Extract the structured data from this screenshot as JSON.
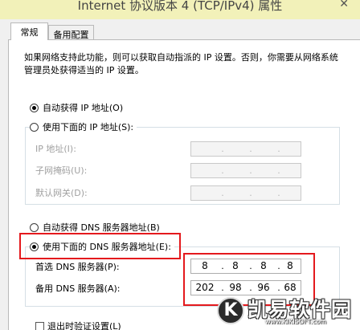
{
  "window": {
    "title": "Internet 协议版本 4 (TCP/IPv4) 属性",
    "close_glyph": "✕"
  },
  "tabs": [
    {
      "label": "常规",
      "active": true
    },
    {
      "label": "备用配置",
      "active": false
    }
  ],
  "description": "如果网络支持此功能，则可以获取自动指派的 IP 设置。否则，你需要从网络系统管理员处获得适当的 IP 设置。",
  "ip_section": {
    "auto_label": "自动获得 IP 地址(O)",
    "auto_selected": true,
    "manual_label": "使用下面的 IP 地址(S):",
    "manual_selected": false,
    "fields": [
      {
        "label": "IP 地址(I):",
        "value": [
          "",
          "",
          "",
          ""
        ],
        "enabled": false
      },
      {
        "label": "子网掩码(U):",
        "value": [
          "",
          "",
          "",
          ""
        ],
        "enabled": false
      },
      {
        "label": "默认网关(D):",
        "value": [
          "",
          "",
          "",
          ""
        ],
        "enabled": false
      }
    ]
  },
  "dns_section": {
    "auto_label": "自动获得 DNS 服务器地址(B)",
    "auto_selected": false,
    "manual_label": "使用下面的 DNS 服务器地址(E):",
    "manual_selected": true,
    "fields": [
      {
        "label": "首选 DNS 服务器(P):",
        "value": [
          "8",
          "8",
          "8",
          "8"
        ],
        "enabled": true
      },
      {
        "label": "备用 DNS 服务器(A):",
        "value": [
          "202",
          "98",
          "96",
          "68"
        ],
        "enabled": true
      }
    ]
  },
  "validate_checkbox": {
    "label": "退出时验证设置(L)",
    "checked": false
  },
  "highlight_color": "#e4191d",
  "watermark": {
    "logo_letter": "K",
    "text": "凯易软件园",
    "url": "www.KIKISOFT.com"
  }
}
